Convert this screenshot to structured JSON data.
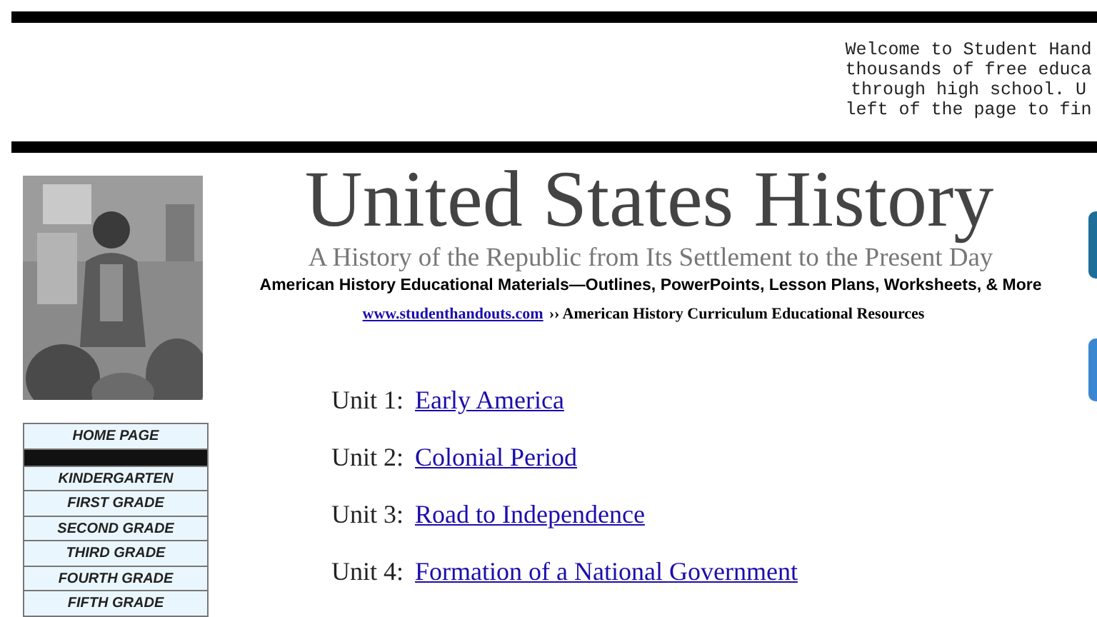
{
  "welcome": {
    "lines": [
      "Welcome to Student Hand",
      "thousands of free educa",
      "through high school. U",
      "left of the page to fin"
    ]
  },
  "sidebar": {
    "nav_items": [
      {
        "kind": "link",
        "label": "HOME PAGE"
      },
      {
        "kind": "separator"
      },
      {
        "kind": "link",
        "label": "KINDERGARTEN"
      },
      {
        "kind": "link",
        "label": "FIRST GRADE"
      },
      {
        "kind": "link",
        "label": "SECOND GRADE"
      },
      {
        "kind": "link",
        "label": "THIRD GRADE"
      },
      {
        "kind": "link",
        "label": "FOURTH GRADE"
      },
      {
        "kind": "link",
        "label": "FIFTH GRADE"
      }
    ]
  },
  "header": {
    "title": "United States History",
    "subtitle": "A History of the Republic from Its Settlement to the Present Day",
    "tagline": "American History Educational Materials—Outlines, PowerPoints, Lesson Plans, Worksheets, & More",
    "site_link": "www.studenthandouts.com",
    "site_suffix": "›› American History Curriculum Educational Resources"
  },
  "units": [
    {
      "number": "Unit 1:",
      "title": "Early America"
    },
    {
      "number": "Unit 2:",
      "title": "Colonial Period"
    },
    {
      "number": "Unit 3:",
      "title": "Road to Independence"
    },
    {
      "number": "Unit 4:",
      "title": "Formation of a National Government"
    }
  ],
  "edge_buttons": [
    {
      "color": "#1f6e9a"
    },
    {
      "color": "#3b86d1"
    }
  ]
}
